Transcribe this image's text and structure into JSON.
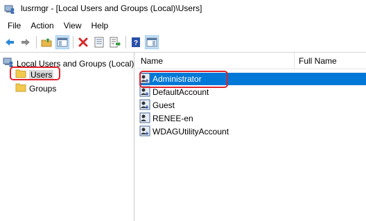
{
  "window": {
    "title": "lusrmgr - [Local Users and Groups (Local)\\Users]"
  },
  "menu": [
    {
      "label": "File"
    },
    {
      "label": "Action"
    },
    {
      "label": "View"
    },
    {
      "label": "Help"
    }
  ],
  "toolbar": {
    "buttons": [
      {
        "name": "back-arrow-icon"
      },
      {
        "name": "forward-arrow-icon"
      },
      {
        "name": "up-folder-icon"
      },
      {
        "name": "show-hide-tree-icon"
      },
      {
        "name": "delete-x-icon"
      },
      {
        "name": "properties-icon"
      },
      {
        "name": "export-list-icon"
      },
      {
        "name": "help-icon"
      },
      {
        "name": "show-action-pane-icon"
      }
    ]
  },
  "tree": {
    "root": {
      "label": "Local Users and Groups (Local)"
    },
    "children": [
      {
        "label": "Users",
        "selected": true
      },
      {
        "label": "Groups",
        "selected": false
      }
    ]
  },
  "list": {
    "columns": [
      {
        "label": "Name"
      },
      {
        "label": "Full Name"
      }
    ],
    "rows": [
      {
        "name": "Administrator",
        "full_name": "",
        "selected": true
      },
      {
        "name": "DefaultAccount",
        "full_name": "",
        "selected": false
      },
      {
        "name": "Guest",
        "full_name": "",
        "selected": false
      },
      {
        "name": "RENEE-en",
        "full_name": "",
        "selected": false
      },
      {
        "name": "WDAGUtilityAccount",
        "full_name": "",
        "selected": false
      }
    ]
  },
  "colors": {
    "selection": "#0078d7",
    "highlight_annotation": "#e0222a",
    "folder": "#f2c94c"
  }
}
